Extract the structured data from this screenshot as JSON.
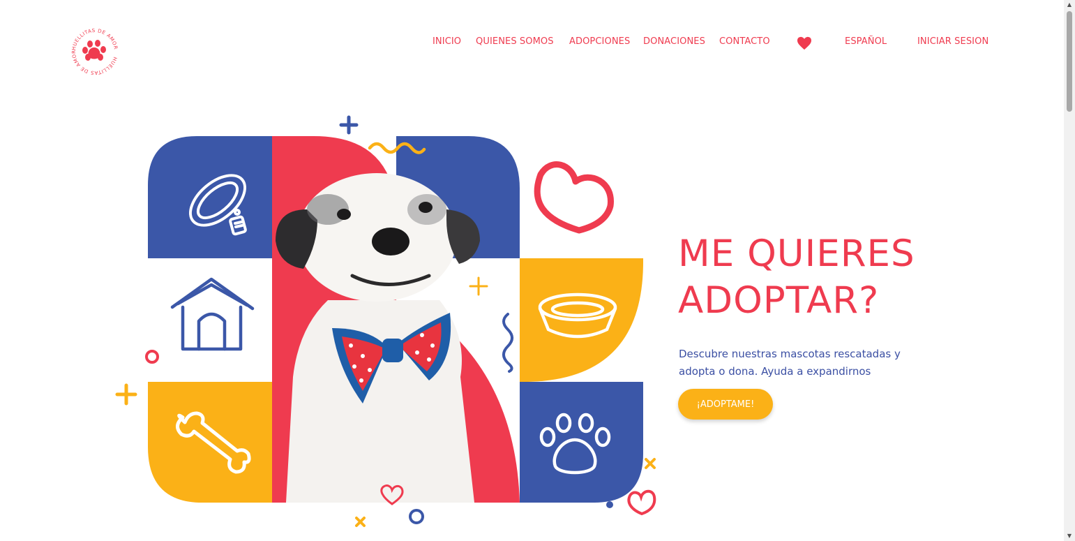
{
  "logo": {
    "text_top": "HUELLITAS DE AMOR",
    "text_bottom": "HUELLITAS DE AMOR"
  },
  "nav": {
    "items": [
      {
        "label": "INICIO"
      },
      {
        "label": "QUIENES SOMOS"
      },
      {
        "label": "ADOPCIONES"
      },
      {
        "label": "DONACIONES"
      },
      {
        "label": "CONTACTO"
      }
    ],
    "language": "ESPAÑOL",
    "login": "INICIAR SESION"
  },
  "hero": {
    "title_line1": "ME QUIERES",
    "title_line2": "ADOPTAR?",
    "description": "Descubre nuestras mascotas rescatadas y adopta o dona. Ayuda a expandirnos",
    "cta": "¡ADOPTAME!"
  },
  "colors": {
    "red": "#ef3b4f",
    "blue": "#3b57a8",
    "yellow": "#fbb117",
    "white": "#ffffff"
  },
  "icons": [
    "paw-icon",
    "heart-icon",
    "collar-icon",
    "doghouse-icon",
    "bone-icon",
    "bowl-icon",
    "dog-photo"
  ]
}
